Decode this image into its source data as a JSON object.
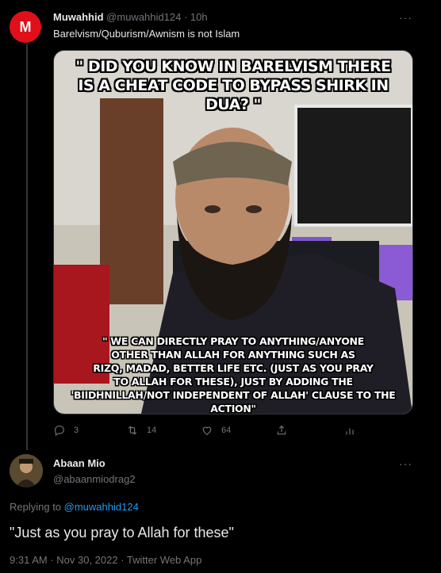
{
  "tweet1": {
    "avatar_letter": "M",
    "name": "Muwahhid",
    "handle": "@muwahhid124",
    "separator": "·",
    "time": "10h",
    "more_icon": "···",
    "text": "Barelvism/Quburism/Awnism is not Islam",
    "media": {
      "caption_top": "\" DID YOU KNOW IN BARELVISM THERE\nIS A CHEAT CODE TO BYPASS SHIRK IN DUA? \"",
      "caption_bottom": "\" WE CAN DIRECTLY PRAY TO ANYTHING/ANYONE\nOTHER THAN ALLAH FOR ANYTHING SUCH AS\nRIZQ, MADAD, BETTER LIFE ETC. (JUST AS YOU PRAY\nTO ALLAH FOR THESE), JUST BY ADDING THE\n'BIIDHNILLAH/NOT INDEPENDENT OF ALLAH' CLAUSE TO THE ACTION\""
    },
    "actions": {
      "reply_count": "3",
      "retweet_count": "14",
      "like_count": "64",
      "icons": [
        "reply-icon",
        "retweet-icon",
        "like-icon",
        "share-icon",
        "analytics-icon"
      ]
    }
  },
  "tweet2": {
    "name": "Abaan Mio",
    "handle": "@abaanmiodrag2",
    "more_icon": "···",
    "replying_prefix": "Replying to ",
    "replying_handle": "@muwahhid124",
    "text": "\"Just as you pray to Allah for these\"",
    "meta": "9:31 AM · Nov 30, 2022 · Twitter Web App"
  },
  "colors": {
    "background": "#000000",
    "text_primary": "#e7e9ea",
    "text_secondary": "#71767b",
    "link": "#1d9bf0",
    "avatar_m": "#e0101a"
  }
}
